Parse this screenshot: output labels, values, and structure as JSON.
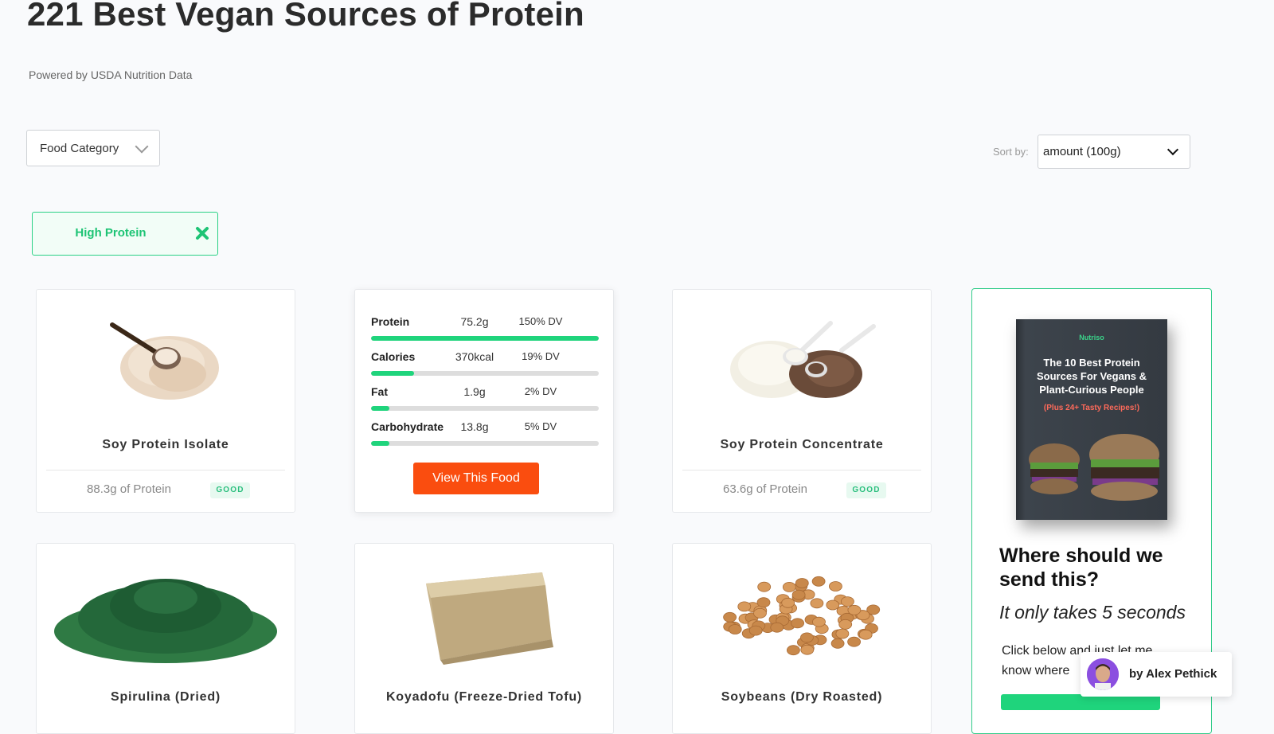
{
  "header": {
    "title": "221 Best Vegan Sources of Protein",
    "powered_by": "Powered by USDA Nutrition Data"
  },
  "filters": {
    "category_label": "Food Category",
    "sort_label": "Sort by:",
    "sort_value": "amount (100g)",
    "active_tag": "High Protein"
  },
  "foods": [
    {
      "name": "Soy Protein Isolate",
      "protein": "88.3g of Protein",
      "badge": "GOOD"
    },
    {
      "name": "Soy Protein Concentrate",
      "protein": "63.6g of Protein",
      "badge": "GOOD"
    },
    {
      "name": "Spirulina (Dried)"
    },
    {
      "name": "Koyadofu (Freeze-Dried Tofu)"
    },
    {
      "name": "Soybeans (Dry Roasted)"
    }
  ],
  "nutrition_card": {
    "rows": [
      {
        "name": "Protein",
        "amount": "75.2g",
        "dv": "150% DV",
        "fill": 1.0
      },
      {
        "name": "Calories",
        "amount": "370kcal",
        "dv": "19% DV",
        "fill": 0.19
      },
      {
        "name": "Fat",
        "amount": "1.9g",
        "dv": "2% DV",
        "fill": 0.08
      },
      {
        "name": "Carbohydrate",
        "amount": "13.8g",
        "dv": "5% DV",
        "fill": 0.08
      }
    ],
    "button_label": "View This Food"
  },
  "promo": {
    "book_brand": "Nutriso",
    "book_title": "The 10 Best Protein Sources For Vegans & Plant-Curious People",
    "book_subtitle": "(Plus 24+ Tasty Recipes!)",
    "heading": "Where should we send this?",
    "subheading": "It only takes 5 seconds",
    "body": "Click below and just let me know where"
  },
  "author": {
    "label": "by Alex Pethick"
  },
  "colors": {
    "accent_green": "#1fd47c",
    "button_orange": "#fa4d0f",
    "badge_green": "#2bbf7e"
  }
}
